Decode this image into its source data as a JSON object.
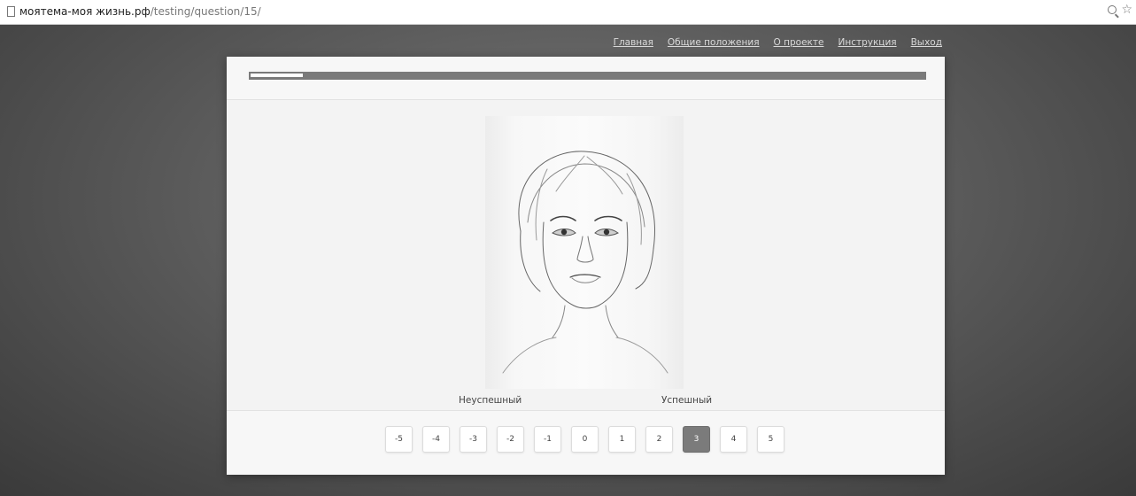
{
  "browser": {
    "url_domain": "моятема-моя жизнь.рф",
    "url_path": "/testing/question/15/"
  },
  "nav": {
    "items": [
      "Главная",
      "Общие положения",
      "О проекте",
      "Инструкция",
      "Выход"
    ]
  },
  "test": {
    "progress_fraction": 0.077,
    "image_alt": "pencil-sketch-portrait-of-woman",
    "scale_left_label": "Неуспешный",
    "scale_right_label": "Успешный",
    "ratings": [
      "-5",
      "-4",
      "-3",
      "-2",
      "-1",
      "0",
      "1",
      "2",
      "3",
      "4",
      "5"
    ],
    "selected_rating": "3"
  },
  "colors": {
    "selected_button": "#7b7b7b",
    "progress_track": "#7a7a7a",
    "progress_fill": "#ffffff"
  }
}
